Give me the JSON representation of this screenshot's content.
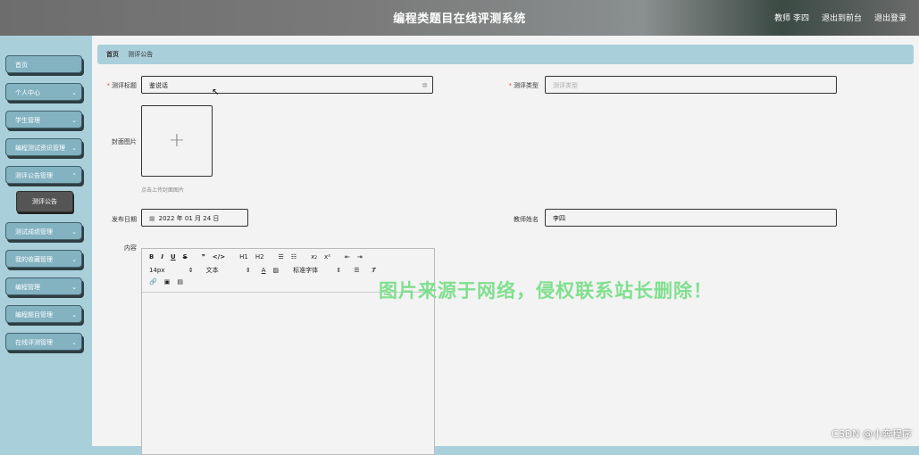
{
  "header": {
    "title": "编程类题目在线评测系统",
    "user": "教师 李四",
    "back_link": "退出到前台",
    "logout": "退出登录"
  },
  "sidebar": {
    "items": [
      {
        "label": "首页"
      },
      {
        "label": "个人中心"
      },
      {
        "label": "学生管理"
      },
      {
        "label": "编程测试资讯管理"
      },
      {
        "label": "测评公告管理"
      },
      {
        "label": "测试成绩管理"
      },
      {
        "label": "我的收藏管理"
      },
      {
        "label": "编程管理"
      },
      {
        "label": "编程题目管理"
      },
      {
        "label": "在线评测管理"
      }
    ],
    "sub_item": "测评公告"
  },
  "breadcrumb": {
    "home": "首页",
    "current": "测评公告"
  },
  "form": {
    "title_label": "测评标题",
    "title_value": "鉴说话",
    "type_label": "测评类型",
    "type_placeholder": "测评类型",
    "cover_label": "封面图片",
    "cover_hint": "点击上传封面图片",
    "date_label": "发布日期",
    "date_value": "2022 年 01 月 24 日",
    "teacher_label": "教师姓名",
    "teacher_value": "李四",
    "content_label": "内容"
  },
  "editor": {
    "row1": [
      "B",
      "I",
      "U",
      "S",
      "❞",
      "</>",
      "H1",
      "H2",
      "☰",
      "☷",
      "x₂",
      "x²",
      "⇤",
      "⇥"
    ],
    "font_size": "14px",
    "text_style": "文本",
    "font_family": "标准字体",
    "row3": [
      "🔗",
      "▣",
      "▤"
    ]
  },
  "watermark": "图片来源于网络，侵权联系站长删除！",
  "csdn": "CSDN @小奔程序"
}
